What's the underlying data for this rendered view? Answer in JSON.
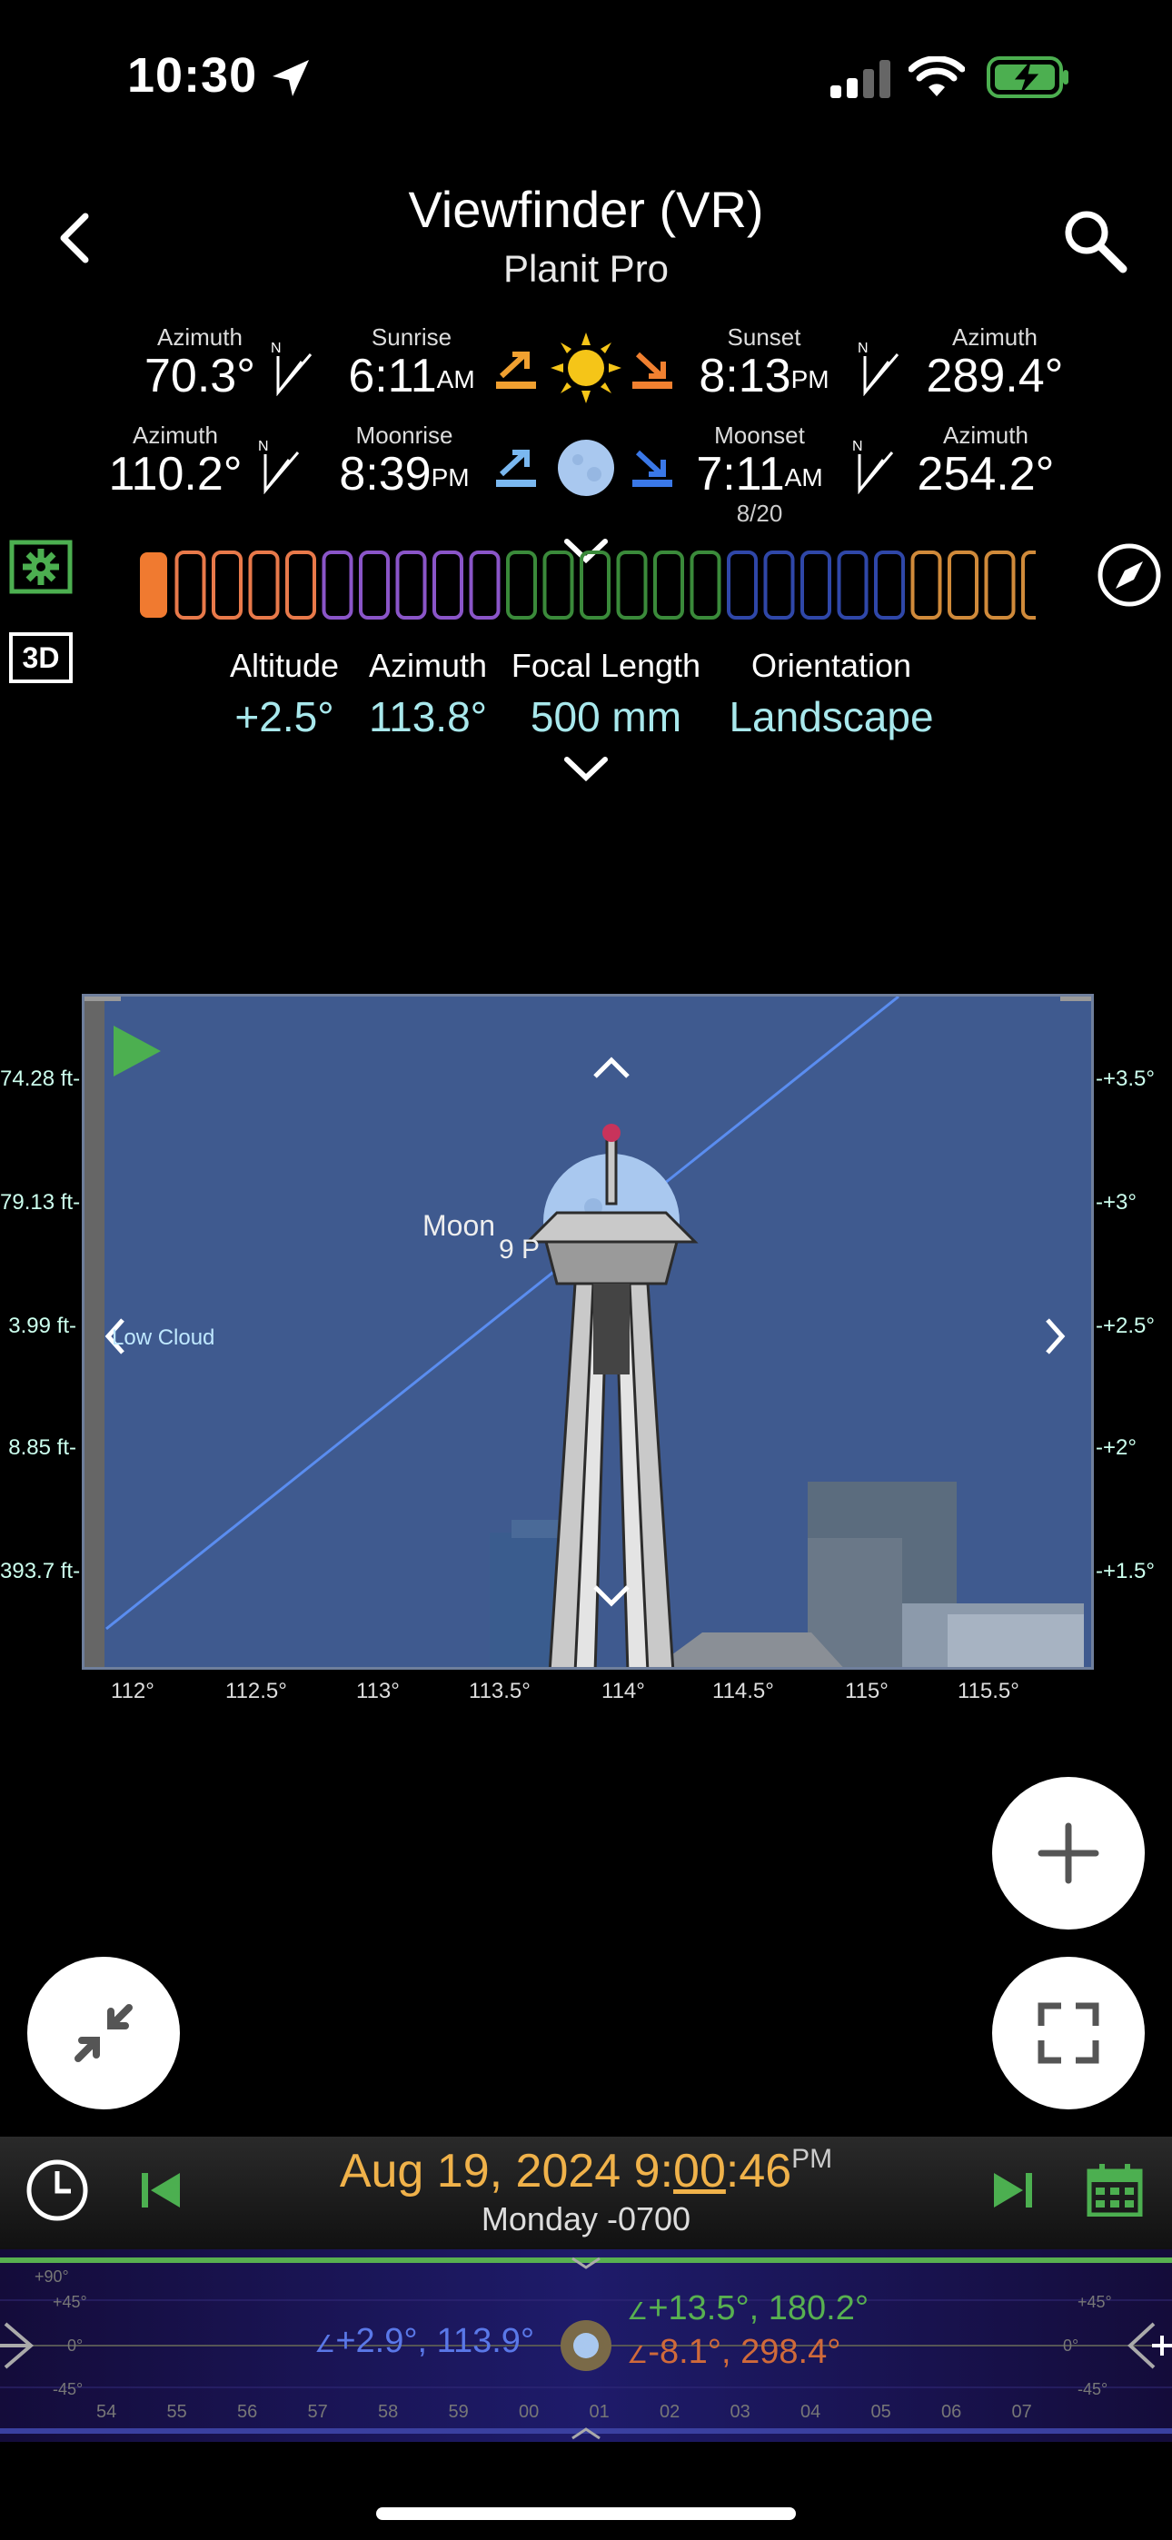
{
  "status": {
    "time": "10:30"
  },
  "header": {
    "title": "Viewfinder (VR)",
    "subtitle": "Planit Pro"
  },
  "sun": {
    "rise_azimuth_label": "Azimuth",
    "rise_azimuth": "70.3°",
    "sunrise_label": "Sunrise",
    "sunrise_time": "6:11",
    "sunrise_ampm": "AM",
    "sunset_label": "Sunset",
    "sunset_time": "8:13",
    "sunset_ampm": "PM",
    "set_azimuth_label": "Azimuth",
    "set_azimuth": "289.4°"
  },
  "moon": {
    "rise_azimuth_label": "Azimuth",
    "rise_azimuth": "110.2°",
    "moonrise_label": "Moonrise",
    "moonrise_time": "8:39",
    "moonrise_ampm": "PM",
    "moonset_label": "Moonset",
    "moonset_time": "7:11",
    "moonset_ampm": "AM",
    "moonset_date": "8/20",
    "set_azimuth_label": "Azimuth",
    "set_azimuth": "254.2°"
  },
  "side": {
    "three_d_label": "3D"
  },
  "params": {
    "altitude_label": "Altitude",
    "altitude": "+2.5°",
    "azimuth_label": "Azimuth",
    "azimuth": "113.8°",
    "focal_label": "Focal Length",
    "focal": "500 mm",
    "orientation_label": "Orientation",
    "orientation": "Landscape"
  },
  "viewfinder": {
    "moon_label": "Moon",
    "time_label": "9 P",
    "cloud_label": "Low Cloud",
    "left_ticks": [
      "74.28 ft-",
      "79.13 ft-",
      "3.99 ft-",
      "8.85 ft-",
      "393.7 ft-"
    ],
    "right_ticks": [
      "-+3.5°",
      "-+3°",
      "-+2.5°",
      "-+2°",
      "-+1.5°"
    ],
    "x_ticks": [
      "112°",
      "112.5°",
      "113°",
      "113.5°",
      "114°",
      "114.5°",
      "115°",
      "115.5°"
    ]
  },
  "timebar": {
    "date": "Aug 19, 2024 9:",
    "minutes": "00",
    "seconds": ":46",
    "ampm": "PM",
    "day": "Monday -0700",
    "sun_pos": "+2.9°, 113.9°",
    "moon_pos": "+13.5°, 180.2°",
    "other_pos": "-8.1°, 298.4°",
    "hour_ticks": [
      "54",
      "55",
      "56",
      "57",
      "58",
      "59",
      "00",
      "01",
      "02",
      "03",
      "04",
      "05",
      "06",
      "07"
    ],
    "left_scale": [
      "+90°",
      "+45°",
      "0°",
      "-45°"
    ],
    "right_scale": [
      "+45°",
      "0°",
      "-45°"
    ]
  },
  "colors": {
    "accent_green": "#4caf50",
    "date_orange": "#f0b24a",
    "param_cyan": "#a8e8ec",
    "sky_blue": "#3f5a8f"
  }
}
